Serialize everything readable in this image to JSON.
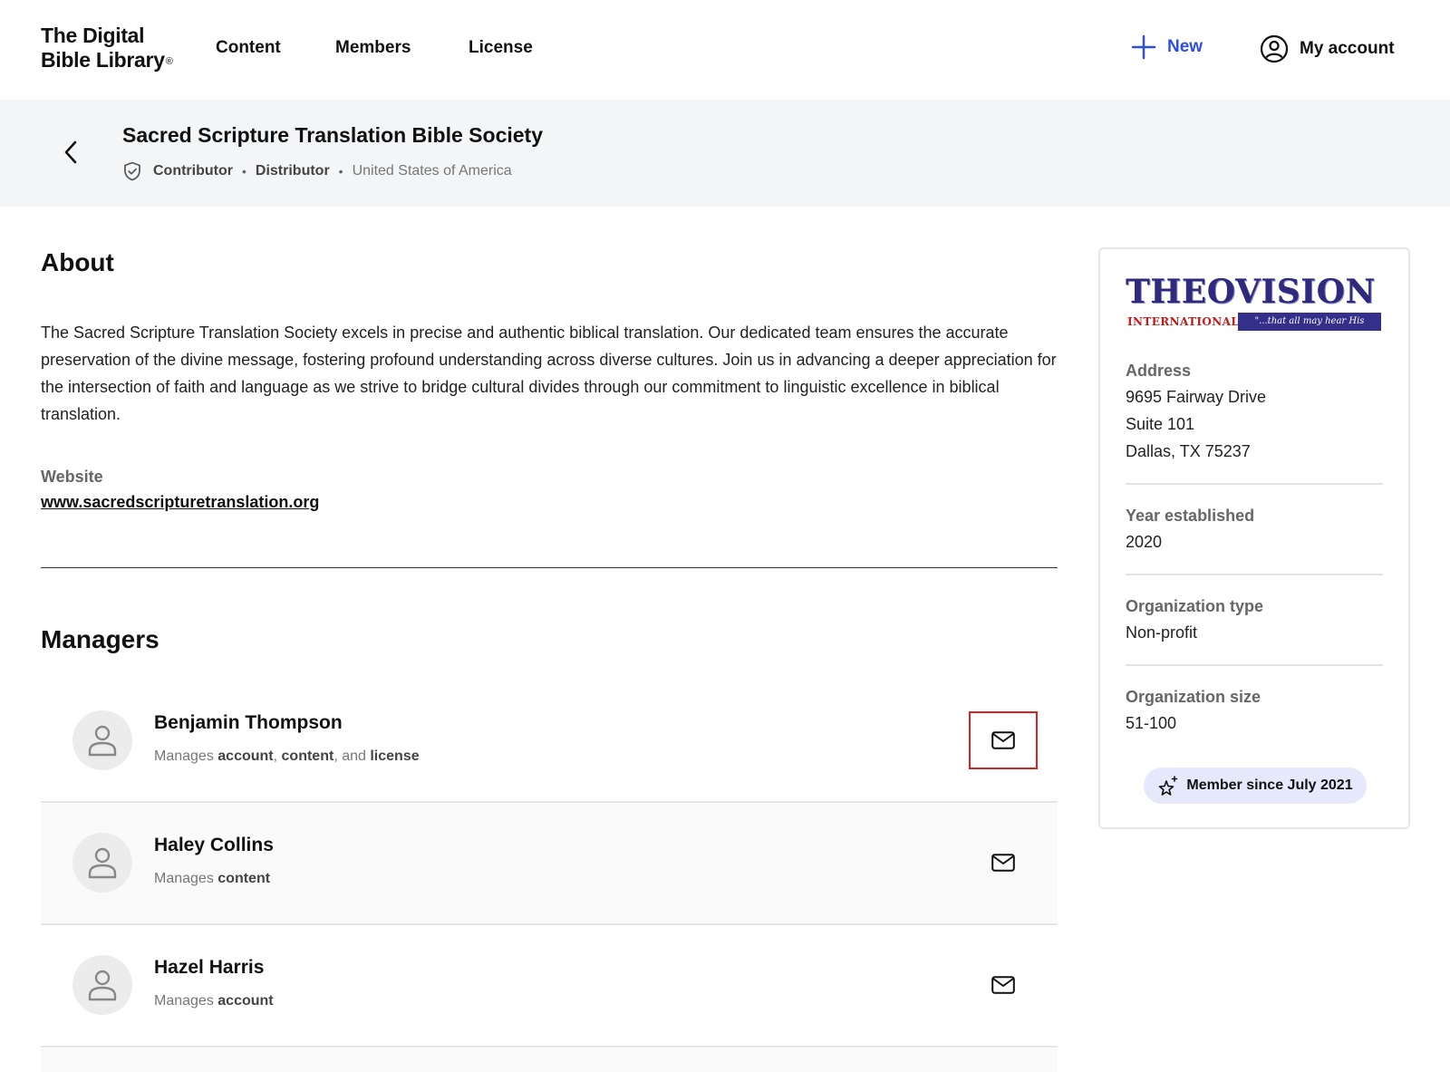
{
  "nav": {
    "logo_line1": "The Digital",
    "logo_line2": "Bible Library",
    "logo_reg": "®",
    "links": [
      "Content",
      "Members",
      "License"
    ],
    "new_label": "New",
    "account_label": "My account"
  },
  "org": {
    "title": "Sacred Scripture Translation Bible Society",
    "role1": "Contributor",
    "role2": "Distributor",
    "separator": "•",
    "country": "United States of America"
  },
  "about": {
    "heading": "About",
    "text": "The Sacred Scripture Translation Society excels in precise and authentic biblical translation. Our dedicated team ensures the accurate preservation of the divine message, fostering profound understanding across diverse cultures. Join us in advancing a deeper appreciation for the intersection of faith and language as we strive to bridge cultural divides through our commitment to linguistic excellence in biblical translation.",
    "website_label": "Website",
    "website_url": "www.sacredscripturetranslation.org"
  },
  "managers": {
    "heading": "Managers",
    "manages_prefix": "Manages",
    "items": [
      {
        "name": "Benjamin Thompson",
        "r1": "account",
        "sep1": ",",
        "r2": "content",
        "sep2": ", and",
        "r3": "license"
      },
      {
        "name": "Haley Collins",
        "r1": "content"
      },
      {
        "name": "Hazel Harris",
        "r1": "account"
      }
    ]
  },
  "side": {
    "logo_word": "THEOVISION",
    "logo_sub": "INTERNATIONAL",
    "logo_tagline": "\"...that all may hear His voice...\"",
    "address_label": "Address",
    "address_line1": "9695 Fairway Drive",
    "address_line2": "Suite 101",
    "address_line3": "Dallas, TX 75237",
    "year_label": "Year established",
    "year_value": "2020",
    "type_label": "Organization type",
    "type_value": "Non-profit",
    "size_label": "Organization size",
    "size_value": "51-100",
    "member_since": "Member since July 2021"
  },
  "colors": {
    "accent": "#2d4fe0",
    "focus_outline": "#e02020",
    "band_bg": "#f4f5f6",
    "badge_bg": "#e6e8fb"
  }
}
